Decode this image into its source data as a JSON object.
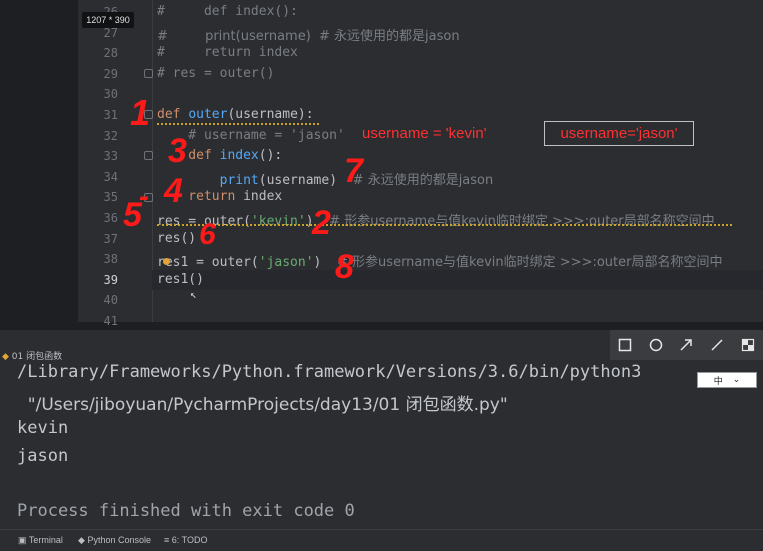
{
  "screenshot_badge": "1207 * 390",
  "editor": {
    "lines": [
      {
        "n": "26",
        "segments": [
          {
            "t": "#     def index():",
            "c": "cmt"
          }
        ]
      },
      {
        "n": "27",
        "segments": [
          {
            "t": "#         print(username)  # 永远使用的都是jason",
            "c": "cmt"
          }
        ]
      },
      {
        "n": "28",
        "segments": [
          {
            "t": "#     return index",
            "c": "cmt"
          }
        ]
      },
      {
        "n": "29",
        "segments": [
          {
            "t": "# res = outer()",
            "c": "cmt"
          }
        ]
      },
      {
        "n": "30",
        "segments": []
      },
      {
        "n": "31",
        "segments": [
          {
            "t": "def ",
            "c": "kw"
          },
          {
            "t": "outer",
            "c": "fn"
          },
          {
            "t": "(username):",
            "c": ""
          }
        ]
      },
      {
        "n": "32",
        "segments": [
          {
            "t": "    # username = 'jason'",
            "c": "cmt"
          }
        ]
      },
      {
        "n": "33",
        "segments": [
          {
            "t": "    def ",
            "c": "kw"
          },
          {
            "t": "index",
            "c": "fn"
          },
          {
            "t": "():",
            "c": ""
          }
        ]
      },
      {
        "n": "34",
        "segments": [
          {
            "t": "        print",
            "c": "fn"
          },
          {
            "t": "(username)  ",
            "c": ""
          },
          {
            "t": "# 永远使用的都是jason",
            "c": "cmt"
          }
        ]
      },
      {
        "n": "35",
        "segments": [
          {
            "t": "    return ",
            "c": "kw"
          },
          {
            "t": "index",
            "c": ""
          }
        ]
      },
      {
        "n": "36",
        "segments": [
          {
            "t": "res = outer(",
            "c": ""
          },
          {
            "t": "'kevin'",
            "c": "str"
          },
          {
            "t": ")  ",
            "c": ""
          },
          {
            "t": "# 形参username与值kevin临时绑定 >>>:outer局部名称空间中",
            "c": "cmt"
          }
        ]
      },
      {
        "n": "37",
        "segments": [
          {
            "t": "res()",
            "c": ""
          }
        ]
      },
      {
        "n": "38",
        "segments": [
          {
            "t": "res1 = outer(",
            "c": ""
          },
          {
            "t": "'jason'",
            "c": "str"
          },
          {
            "t": ")  ",
            "c": ""
          },
          {
            "t": "# 形参username与值kevin临时绑定 >>>:outer局部名称空间中",
            "c": "cmt"
          }
        ]
      },
      {
        "n": "39",
        "segments": [
          {
            "t": "res1()",
            "c": ""
          }
        ]
      },
      {
        "n": "40",
        "segments": []
      },
      {
        "n": "41",
        "segments": []
      }
    ]
  },
  "annotations": {
    "typed_note": "username = 'kevin'",
    "boxed_note": "username='jason'",
    "hand_numbers": [
      "1",
      "2",
      "3",
      "4",
      "5",
      "6",
      "7",
      "8"
    ]
  },
  "toolbar": {
    "tools": [
      "rectangle-icon",
      "ellipse-icon",
      "arrow-icon",
      "line-icon",
      "mosaic-icon"
    ],
    "language_select": "中"
  },
  "run_panel": {
    "tab_label": "01 闭包函数",
    "output": [
      "/Library/Frameworks/Python.framework/Versions/3.6/bin/python3",
      "  \"/Users/jiboyuan/PycharmProjects/day13/01 闭包函数.py\"",
      "kevin",
      "jason",
      "",
      "Process finished with exit code 0"
    ]
  },
  "statusbar": {
    "items": [
      "Terminal",
      "Python Console",
      "6: TODO"
    ]
  }
}
